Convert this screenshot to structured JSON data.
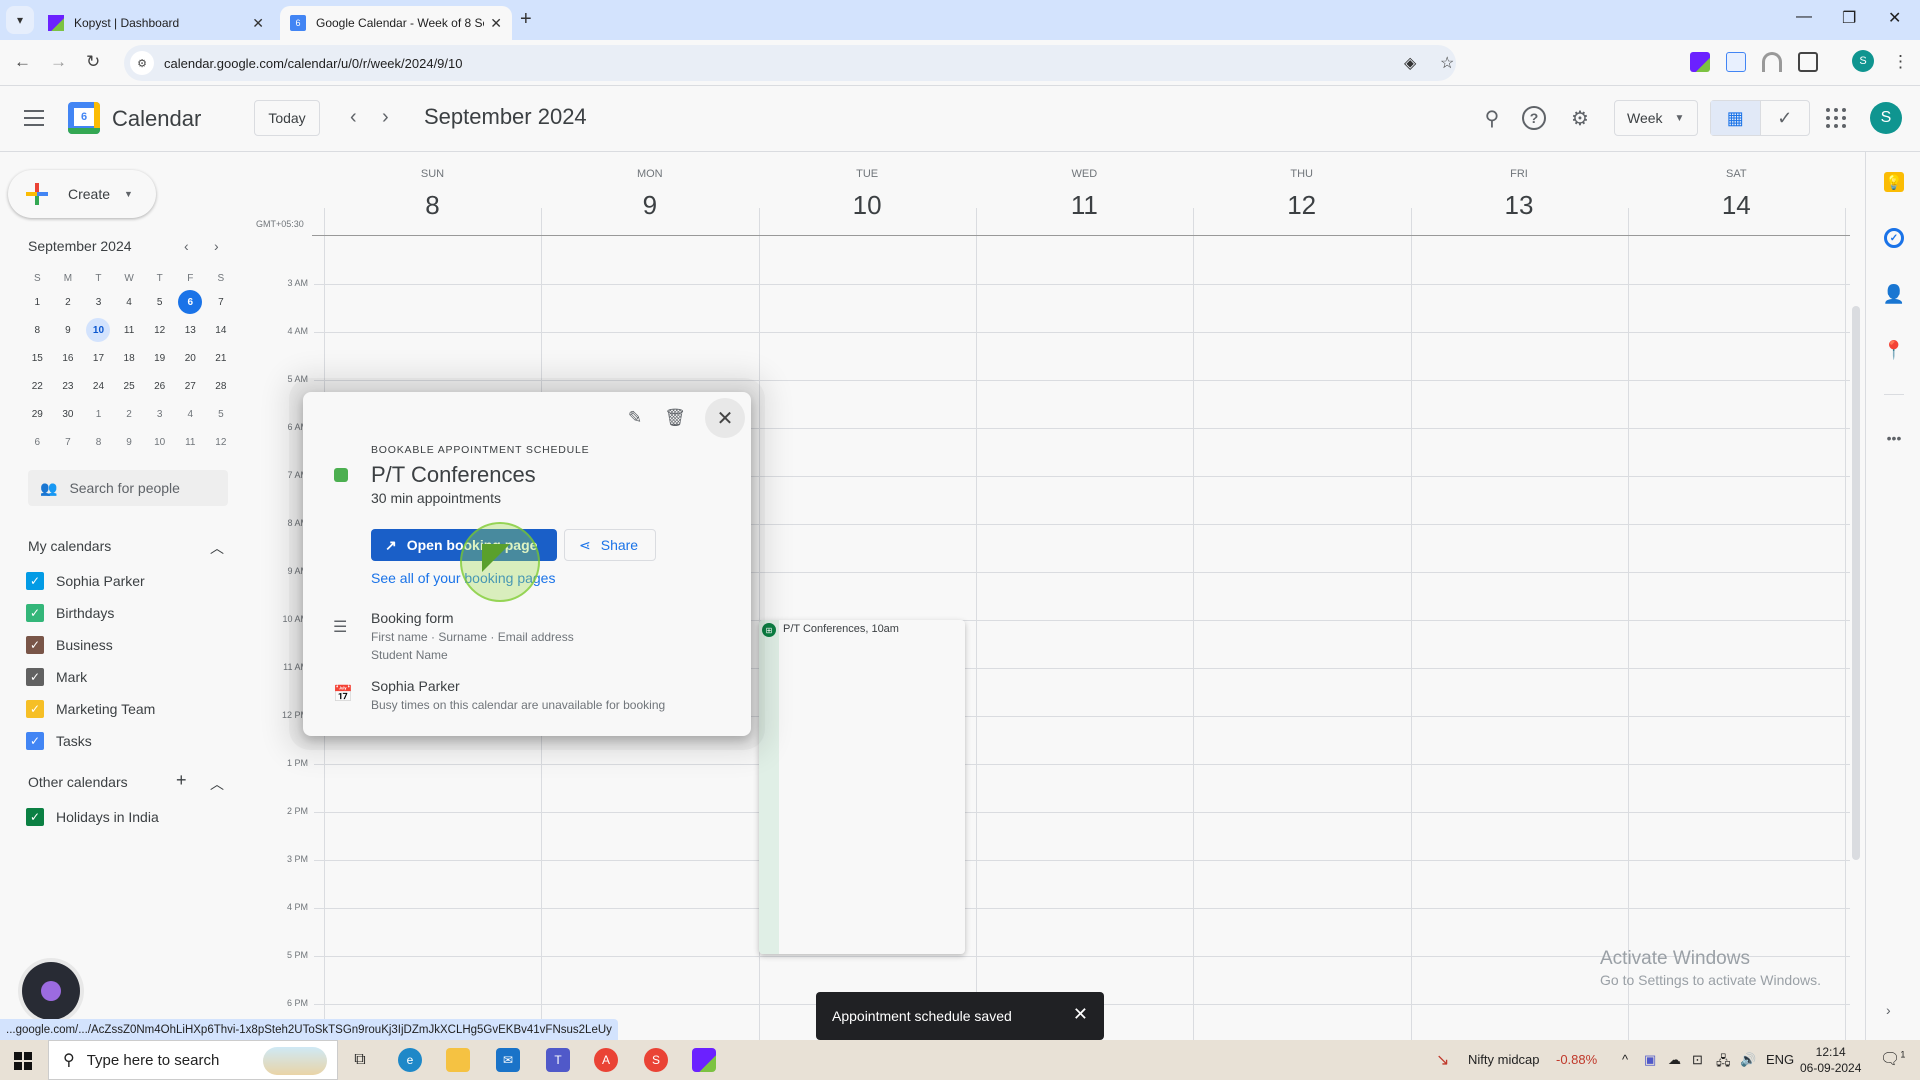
{
  "browser": {
    "tabs": [
      {
        "title": "Kopyst | Dashboard",
        "active": false,
        "favicon": "kopyst-icon"
      },
      {
        "title": "Google Calendar - Week of 8 Se",
        "active": true,
        "favicon": "google-calendar-icon"
      }
    ],
    "new_tab": "+",
    "url": "calendar.google.com/calendar/u/0/r/week/2024/9/10",
    "profile_initial": "S",
    "status_url": "...google.com/.../AcZssZ0Nm4OhLiHXp6Thvi-1x8pSteh2UToSkTSGn9rouKj3IjDZmJkXCLHg5GvEKBv41vFNsus2LeUy"
  },
  "header": {
    "app_name": "Calendar",
    "logo_day": "6",
    "today_label": "Today",
    "period_title": "September 2024",
    "view_selector": "Week",
    "avatar_initial": "S"
  },
  "sidebar": {
    "create_label": "Create",
    "mini_calendar": {
      "title": "September 2024",
      "weekday_headers": [
        "S",
        "M",
        "T",
        "W",
        "T",
        "F",
        "S"
      ],
      "weeks": [
        [
          "1",
          "2",
          "3",
          "4",
          "5",
          "6",
          "7"
        ],
        [
          "8",
          "9",
          "10",
          "11",
          "12",
          "13",
          "14"
        ],
        [
          "15",
          "16",
          "17",
          "18",
          "19",
          "20",
          "21"
        ],
        [
          "22",
          "23",
          "24",
          "25",
          "26",
          "27",
          "28"
        ],
        [
          "29",
          "30",
          "1",
          "2",
          "3",
          "4",
          "5"
        ],
        [
          "6",
          "7",
          "8",
          "9",
          "10",
          "11",
          "12"
        ]
      ],
      "today": "6",
      "selected": "10"
    },
    "people_search_placeholder": "Search for people",
    "my_calendars_label": "My calendars",
    "my_calendars": [
      {
        "name": "Sophia Parker",
        "color": "#039be5",
        "checked": true
      },
      {
        "name": "Birthdays",
        "color": "#33b679",
        "checked": true
      },
      {
        "name": "Business",
        "color": "#795548",
        "checked": true
      },
      {
        "name": "Mark",
        "color": "#616161",
        "checked": true
      },
      {
        "name": "Marketing Team",
        "color": "#f6bf26",
        "checked": true
      },
      {
        "name": "Tasks",
        "color": "#4285f4",
        "checked": true
      }
    ],
    "other_calendars_label": "Other calendars",
    "other_calendars": [
      {
        "name": "Holidays in India",
        "color": "#0b8043",
        "checked": true
      }
    ]
  },
  "week": {
    "timezone": "GMT+05:30",
    "days": [
      {
        "name": "SUN",
        "date": "8"
      },
      {
        "name": "MON",
        "date": "9"
      },
      {
        "name": "TUE",
        "date": "10"
      },
      {
        "name": "WED",
        "date": "11"
      },
      {
        "name": "THU",
        "date": "12"
      },
      {
        "name": "FRI",
        "date": "13"
      },
      {
        "name": "SAT",
        "date": "14"
      }
    ],
    "hours": [
      "3 AM",
      "4 AM",
      "5 AM",
      "6 AM",
      "7 AM",
      "8 AM",
      "9 AM",
      "10 AM",
      "11 AM",
      "12 PM",
      "1 PM",
      "2 PM",
      "3 PM",
      "4 PM",
      "5 PM",
      "6 PM"
    ]
  },
  "event": {
    "title": "P/T Conferences, 10am",
    "day": "TUE",
    "color": "#0b8043"
  },
  "popup": {
    "kicker": "BOOKABLE APPOINTMENT SCHEDULE",
    "title": "P/T Conferences",
    "subtitle": "30 min appointments",
    "color": "#4caf50",
    "open_booking_label": "Open booking page",
    "share_label": "Share",
    "see_all_link": "See all of your booking pages",
    "booking_form_title": "Booking form",
    "booking_form_fields": "First name · Surname · Email address",
    "booking_form_extra": "Student Name",
    "calendar_owner": "Sophia Parker",
    "calendar_note": "Busy times on this calendar are unavailable for booking"
  },
  "snackbar": {
    "message": "Appointment schedule saved"
  },
  "watermark": {
    "line1": "Activate Windows",
    "line2": "Go to Settings to activate Windows."
  },
  "taskbar": {
    "search_placeholder": "Type here to search",
    "ticker_name": "Nifty midcap",
    "ticker_change": "-0.88%",
    "language": "ENG",
    "time": "12:14",
    "date": "06-09-2024",
    "notification_count": "1"
  }
}
